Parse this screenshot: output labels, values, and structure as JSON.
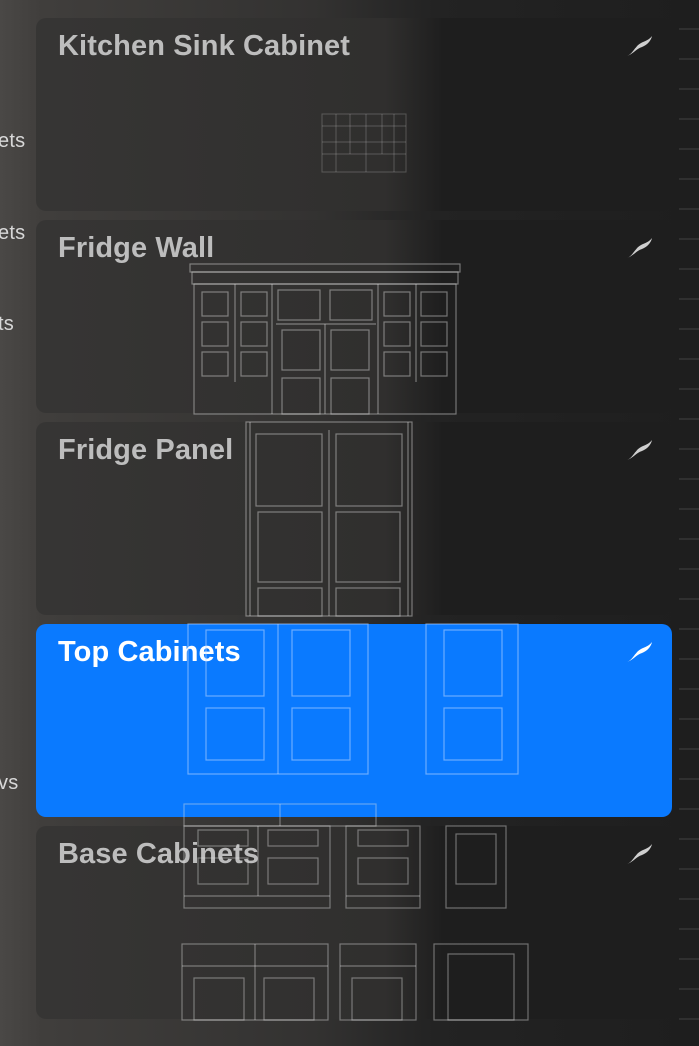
{
  "side_labels": [
    {
      "text": "ets"
    },
    {
      "text": "ets"
    },
    {
      "text": "ts"
    },
    {
      "text": "vs"
    }
  ],
  "brushes": [
    {
      "name": "Kitchen Sink Cabinet",
      "icon": "brush-stroke-icon",
      "selected": false
    },
    {
      "name": "Fridge Wall",
      "icon": "brush-stroke-icon",
      "selected": false
    },
    {
      "name": "Fridge Panel",
      "icon": "brush-stroke-icon",
      "selected": false
    },
    {
      "name": "Top Cabinets",
      "icon": "brush-stroke-icon",
      "selected": true
    },
    {
      "name": "Base Cabinets",
      "icon": "brush-stroke-icon",
      "selected": false
    }
  ],
  "colors": {
    "selected": "#0a7aff",
    "title_text": "#bdbdbd",
    "selected_text": "#ffffff"
  }
}
